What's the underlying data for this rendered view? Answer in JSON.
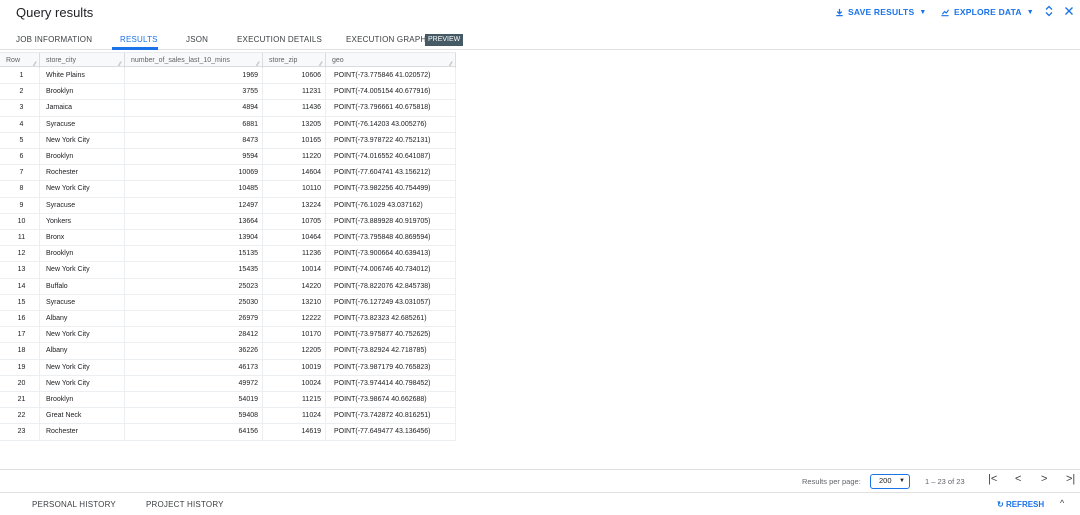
{
  "header": {
    "title": "Query results",
    "save_results": "SAVE RESULTS",
    "explore_data": "EXPLORE DATA"
  },
  "tabs": {
    "job_information": "JOB INFORMATION",
    "results": "RESULTS",
    "json": "JSON",
    "execution_details": "EXECUTION DETAILS",
    "execution_graph": "EXECUTION GRAPH",
    "preview_badge": "PREVIEW"
  },
  "table": {
    "columns": [
      "Row",
      "store_city",
      "number_of_sales_last_10_mins",
      "store_zip",
      "geo"
    ],
    "rows": [
      [
        "1",
        "White Plains",
        "1969",
        "10606",
        "POINT(-73.775846 41.020572)"
      ],
      [
        "2",
        "Brooklyn",
        "3755",
        "11231",
        "POINT(-74.005154 40.677916)"
      ],
      [
        "3",
        "Jamaica",
        "4894",
        "11436",
        "POINT(-73.796661 40.675818)"
      ],
      [
        "4",
        "Syracuse",
        "6881",
        "13205",
        "POINT(-76.14203 43.005276)"
      ],
      [
        "5",
        "New York City",
        "8473",
        "10165",
        "POINT(-73.978722 40.752131)"
      ],
      [
        "6",
        "Brooklyn",
        "9594",
        "11220",
        "POINT(-74.016552 40.641087)"
      ],
      [
        "7",
        "Rochester",
        "10069",
        "14604",
        "POINT(-77.604741 43.156212)"
      ],
      [
        "8",
        "New York City",
        "10485",
        "10110",
        "POINT(-73.982256 40.754499)"
      ],
      [
        "9",
        "Syracuse",
        "12497",
        "13224",
        "POINT(-76.1029 43.037162)"
      ],
      [
        "10",
        "Yonkers",
        "13664",
        "10705",
        "POINT(-73.889928 40.919705)"
      ],
      [
        "11",
        "Bronx",
        "13904",
        "10464",
        "POINT(-73.795848 40.869594)"
      ],
      [
        "12",
        "Brooklyn",
        "15135",
        "11236",
        "POINT(-73.900664 40.639413)"
      ],
      [
        "13",
        "New York City",
        "15435",
        "10014",
        "POINT(-74.006746 40.734012)"
      ],
      [
        "14",
        "Buffalo",
        "25023",
        "14220",
        "POINT(-78.822076 42.845738)"
      ],
      [
        "15",
        "Syracuse",
        "25030",
        "13210",
        "POINT(-76.127249 43.031057)"
      ],
      [
        "16",
        "Albany",
        "26979",
        "12222",
        "POINT(-73.82323 42.685261)"
      ],
      [
        "17",
        "New York City",
        "28412",
        "10170",
        "POINT(-73.975877 40.752625)"
      ],
      [
        "18",
        "Albany",
        "36226",
        "12205",
        "POINT(-73.82924 42.718785)"
      ],
      [
        "19",
        "New York City",
        "46173",
        "10019",
        "POINT(-73.987179 40.765823)"
      ],
      [
        "20",
        "New York City",
        "49972",
        "10024",
        "POINT(-73.974414 40.798452)"
      ],
      [
        "21",
        "Brooklyn",
        "54019",
        "11215",
        "POINT(-73.98674 40.662688)"
      ],
      [
        "22",
        "Great Neck",
        "59408",
        "11024",
        "POINT(-73.742872 40.816251)"
      ],
      [
        "23",
        "Rochester",
        "64156",
        "14619",
        "POINT(-77.649477 43.136456)"
      ]
    ]
  },
  "pagination": {
    "results_per_page_label": "Results per page:",
    "results_per_page_value": "200",
    "page_info": "1 – 23 of 23"
  },
  "bottom": {
    "personal_history": "PERSONAL HISTORY",
    "project_history": "PROJECT HISTORY",
    "refresh": "REFRESH"
  },
  "colors": {
    "accent": "#1a73e8",
    "badge": "#455a64"
  }
}
